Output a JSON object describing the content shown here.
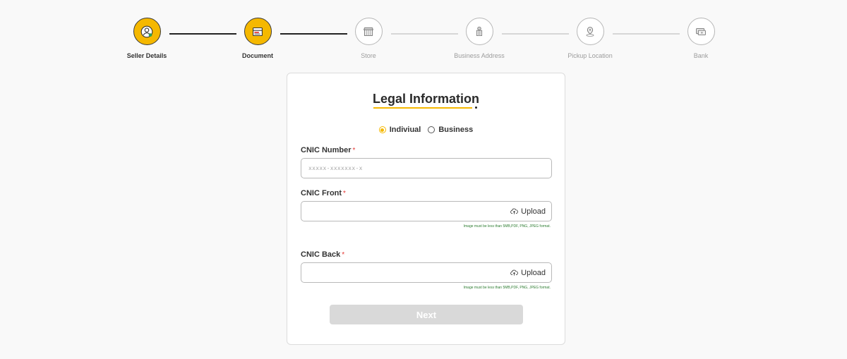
{
  "stepper": {
    "steps": [
      {
        "label": "Seller Details",
        "icon": "seller-icon",
        "state": "done"
      },
      {
        "label": "Document",
        "icon": "document-icon",
        "state": "done"
      },
      {
        "label": "Store",
        "icon": "store-icon",
        "state": "pending"
      },
      {
        "label": "Business Address",
        "icon": "business-address-icon",
        "state": "pending"
      },
      {
        "label": "Pickup Location",
        "icon": "pickup-location-icon",
        "state": "pending"
      },
      {
        "label": "Bank",
        "icon": "bank-icon",
        "state": "pending"
      }
    ]
  },
  "colors": {
    "accent": "#f5b800",
    "hint": "#2e7d32",
    "required": "#e53935",
    "button_disabled": "#d9d9d9"
  },
  "form": {
    "title": "Legal Information",
    "type_options": [
      {
        "label": "Indiviual",
        "selected": true
      },
      {
        "label": "Business",
        "selected": false
      }
    ],
    "required_mark": "*",
    "cnic_number": {
      "label": "CNIC Number",
      "value": "",
      "placeholder": "xxxxx-xxxxxxx-x"
    },
    "cnic_front": {
      "label": "CNIC Front",
      "upload_label": "Upload",
      "hint": "Image must be less than 5MB,PDF, PNG, JPEG format."
    },
    "cnic_back": {
      "label": "CNIC Back",
      "upload_label": "Upload",
      "hint": "Image must be less than 5MB,PDF, PNG, JPEG format."
    },
    "next_label": "Next"
  }
}
